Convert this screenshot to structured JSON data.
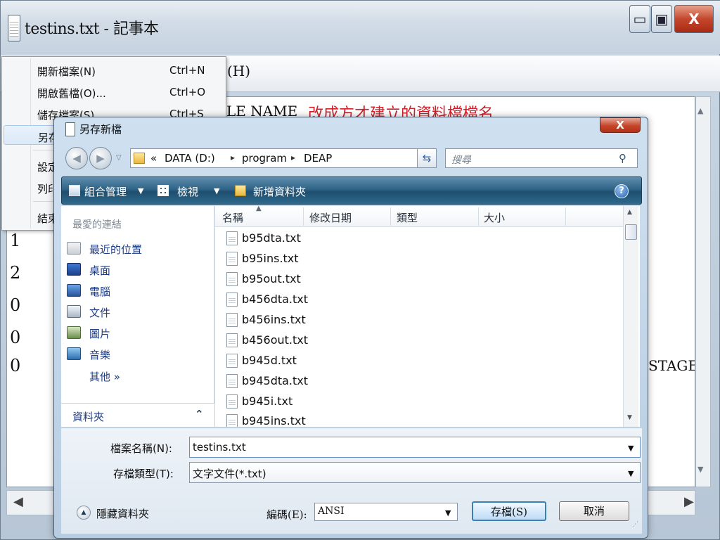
{
  "notepad": {
    "title": "testins.txt - 記事本",
    "caption": {
      "minimize": "▭",
      "maximize": "▣",
      "close": "X"
    },
    "menubar": {
      "help_label": "(H)"
    },
    "text": {
      "line1_left": "LE NAME",
      "line1_note": "改成方才建立的資料檔檔名",
      "digits": [
        "1",
        "2",
        "0",
        "0",
        "0"
      ],
      "right_fragment": "STAGE);"
    }
  },
  "file_menu": {
    "items": [
      {
        "label": "開新檔案(N)",
        "shortcut": "Ctrl+N"
      },
      {
        "label": "開啟舊檔(O)...",
        "shortcut": "Ctrl+O"
      },
      {
        "label": "儲存檔案(S)",
        "shortcut": "Ctrl+S"
      },
      {
        "label": "另存",
        "shortcut": ""
      },
      {
        "label": "設定",
        "shortcut": ""
      },
      {
        "label": "列印",
        "shortcut": ""
      },
      {
        "label": "結束",
        "shortcut": ""
      }
    ]
  },
  "dialog": {
    "title": "另存新檔",
    "close_label": "X",
    "address": {
      "prefix": "«",
      "crumbs": [
        "DATA (D:)",
        "program",
        "DEAP"
      ]
    },
    "search_placeholder": "搜尋",
    "toolbar": {
      "organize": "組合管理",
      "views": "檢視",
      "new_folder": "新增資料夾",
      "help": "?"
    },
    "nav": {
      "favorites_header": "最愛的連結",
      "links": [
        "最近的位置",
        "桌面",
        "電腦",
        "文件",
        "圖片",
        "音樂"
      ],
      "more": "其他 »",
      "folders_label": "資料夾"
    },
    "columns": [
      "名稱",
      "修改日期",
      "類型",
      "大小"
    ],
    "files": [
      "b95dta.txt",
      "b95ins.txt",
      "b95out.txt",
      "b456dta.txt",
      "b456ins.txt",
      "b456out.txt",
      "b945d.txt",
      "b945dta.txt",
      "b945i.txt",
      "b945ins.txt"
    ],
    "filename": {
      "label": "檔案名稱(N):",
      "value": "testins.txt"
    },
    "filetype": {
      "label": "存檔類型(T):",
      "value": "文字文件(*.txt)"
    },
    "hide_folders": "隱藏資料夾",
    "encoding": {
      "label": "編碼(E):",
      "value": "ANSI"
    },
    "buttons": {
      "save": "存檔(S)",
      "cancel": "取消"
    }
  },
  "colors": {
    "accent_red": "#d0202a",
    "link_blue": "#1f3d84",
    "command_bar": "#2f6487"
  }
}
